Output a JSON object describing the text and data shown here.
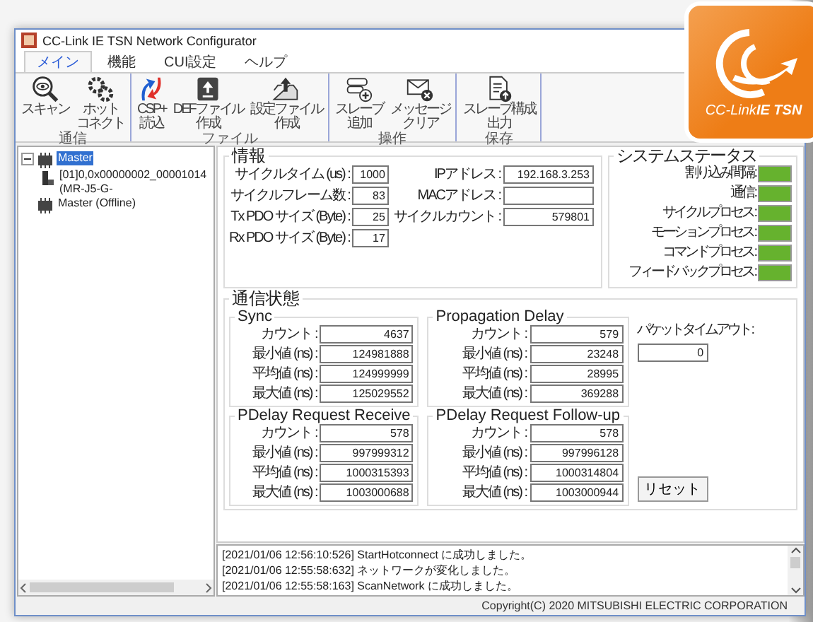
{
  "window": {
    "title": "CC-Link IE TSN Network Configurator"
  },
  "logo": {
    "text": "CC-Link**IE TSN**"
  },
  "tabs": [
    {
      "label": "メイン",
      "selected": true
    },
    {
      "label": "機能",
      "selected": false
    },
    {
      "label": "CUI設定",
      "selected": false
    },
    {
      "label": "ヘルプ",
      "selected": false
    }
  ],
  "ribbon_groups": [
    {
      "label": "通信",
      "buttons": [
        {
          "lines": [
            "スキャン"
          ],
          "kind": "scan"
        },
        {
          "lines": [
            "ホット",
            "コネクト"
          ],
          "kind": "gears"
        }
      ]
    },
    {
      "label": "ファイル",
      "buttons": [
        {
          "lines": [
            "CSP+",
            "読込"
          ],
          "kind": "arrows"
        },
        {
          "lines": [
            "DEFファイル",
            "作成"
          ],
          "kind": "upload"
        },
        {
          "lines": [
            "設定ファイル",
            "作成"
          ],
          "kind": "tray"
        }
      ]
    },
    {
      "label": "操作",
      "buttons": [
        {
          "lines": [
            "スレーブ",
            "追加"
          ],
          "kind": "device-add"
        },
        {
          "lines": [
            "メッセージ",
            "クリア"
          ],
          "kind": "mail-x"
        }
      ]
    },
    {
      "label": "保存",
      "buttons": [
        {
          "lines": [
            "スレーブ構成",
            "出力"
          ],
          "kind": "doc"
        }
      ]
    }
  ],
  "tree": [
    {
      "label": "Master",
      "selected": true,
      "expanded": true,
      "children": [
        {
          "label": "[01]0,0x00000002_00001014 (MR-J5-G-",
          "selected": false
        }
      ]
    },
    {
      "label": "Master (Offline)",
      "selected": false
    }
  ],
  "info": {
    "title": "情報",
    "left_fields": [
      {
        "label": "サイクルタイム (us) :",
        "value": "1000"
      },
      {
        "label": "サイクルフレーム数 :",
        "value": "83"
      },
      {
        "label": "Tx PDO サイズ (Byte) :",
        "value": "25"
      },
      {
        "label": "Rx PDO サイズ (Byte) :",
        "value": "17"
      }
    ],
    "right_fields": [
      {
        "label": "IPアドレス :",
        "value": "192.168.3.253"
      },
      {
        "label": "MACアドレス :"
      },
      {
        "label": "サイクルカウント :",
        "value": "579801"
      }
    ]
  },
  "system_status": {
    "title": "システムステータス",
    "items": [
      {
        "label": "割り込み間隔 :",
        "color": "#66b22e"
      },
      {
        "label": "通信 :",
        "color": "#66b22e"
      },
      {
        "label": "サイクルプロセス :",
        "color": "#66b22e"
      },
      {
        "label": "モーションプロセス :",
        "color": "#66b22e"
      },
      {
        "label": "コマンドプロセス :",
        "color": "#66b22e"
      },
      {
        "label": "フィードバックプロセス :",
        "color": "#66b22e"
      }
    ]
  },
  "comm_status": {
    "title": "通信状態",
    "groups": [
      {
        "title": "Sync",
        "rows": [
          {
            "label": "カウント :",
            "value": "4637"
          },
          {
            "label": "最小値 (ns) :",
            "value": "124981888"
          },
          {
            "label": "平均値 (ns) :",
            "value": "124999999"
          },
          {
            "label": "最大値 (ns) :",
            "value": "125029552"
          }
        ]
      },
      {
        "title": "Propagation Delay",
        "rows": [
          {
            "label": "カウント :",
            "value": "579"
          },
          {
            "label": "最小値 (ns) :",
            "value": "23248"
          },
          {
            "label": "平均値 (ns) :",
            "value": "28995"
          },
          {
            "label": "最大値 (ns) :",
            "value": "369288"
          }
        ]
      },
      {
        "title": "PDelay Request Receive",
        "rows": [
          {
            "label": "カウント :",
            "value": "578"
          },
          {
            "label": "最小値 (ns) :",
            "value": "997999312"
          },
          {
            "label": "平均値 (ns) :",
            "value": "1000315393"
          },
          {
            "label": "最大値 (ns) :",
            "value": "1003000688"
          }
        ]
      },
      {
        "title": "PDelay Request Follow-up",
        "rows": [
          {
            "label": "カウント :",
            "value": "578"
          },
          {
            "label": "最小値 (ns) :",
            "value": "997996128"
          },
          {
            "label": "平均値 (ns) :",
            "value": "1000314804"
          },
          {
            "label": "最大値 (ns) :",
            "value": "1003000944"
          }
        ]
      }
    ],
    "packet_timeout": {
      "label": "パケットタイムアウト :",
      "value": "0"
    },
    "reset_button": "リセット"
  },
  "log": [
    "[2021/01/06 12:56:10:526] StartHotconnect に成功しました。",
    "[2021/01/06 12:55:58:632] ネットワークが変化しました。",
    "[2021/01/06 12:55:58:163] ScanNetwork に成功しました。"
  ],
  "status_bar": {
    "text": "Copyright(C) 2020 MITSUBISHI ELECTRIC CORPORATION"
  }
}
